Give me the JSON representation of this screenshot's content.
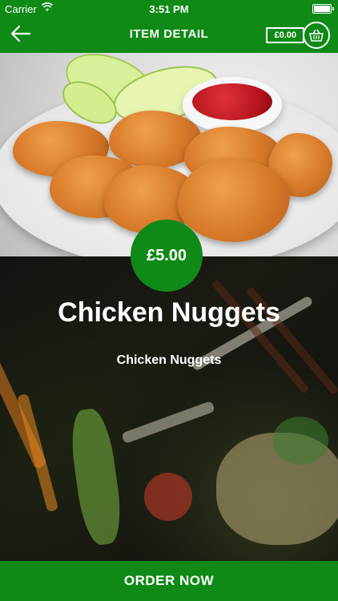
{
  "status_bar": {
    "carrier": "Carrier",
    "time": "3:51 PM"
  },
  "nav": {
    "title": "ITEM DETAIL",
    "back_icon": "arrow-left-icon",
    "cart_total": "£0.00",
    "cart_icon": "basket-icon"
  },
  "item": {
    "price": "£5.00",
    "name": "Chicken Nuggets",
    "description": "Chicken Nuggets"
  },
  "footer": {
    "order_label": "ORDER NOW"
  },
  "colors": {
    "brand_green": "#0f8a16"
  }
}
